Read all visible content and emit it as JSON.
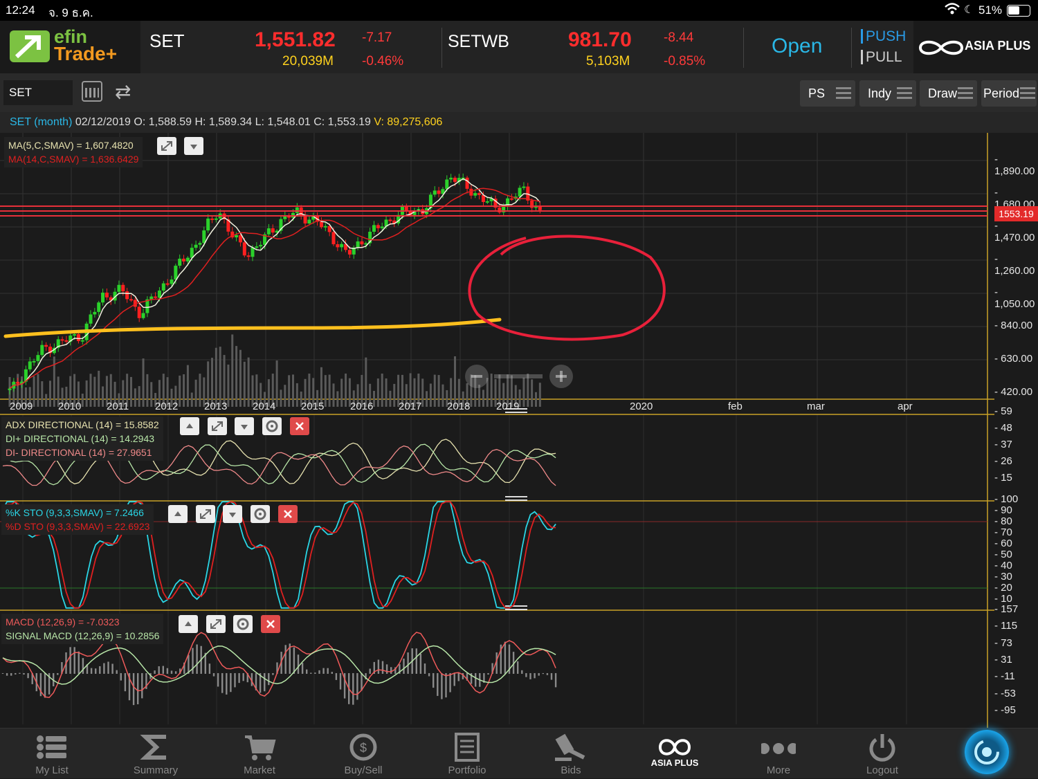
{
  "status": {
    "time": "12:24",
    "date": "จ. 9 ธ.ค.",
    "battery": "51%"
  },
  "header": {
    "logo_top": "efin",
    "logo_bottom": "Trade+",
    "set": {
      "name": "SET",
      "price": "1,551.82",
      "change": "-7.17",
      "volume": "20,039M",
      "pct": "-0.46%"
    },
    "setwb": {
      "name": "SETWB",
      "price": "981.70",
      "change": "-8.44",
      "volume": "5,103M",
      "pct": "-0.85%"
    },
    "market_status": "Open",
    "push": "PUSH",
    "pull": "PULL",
    "broker": "ASIA PLUS"
  },
  "toolbar": {
    "symbol": "SET",
    "ps": "PS",
    "indy": "Indy",
    "draw": "Draw",
    "period": "Period"
  },
  "info": {
    "title": "SET (month)",
    "date": "02/12/2019",
    "o_label": "O:",
    "o": "1,588.59",
    "h_label": "H:",
    "h": "1,589.34",
    "l_label": "L:",
    "l": "1,548.01",
    "c_label": "C:",
    "c": "1,553.19",
    "v_label": "V:",
    "v": "89,275,606"
  },
  "price_panel": {
    "ma5": "MA(5,C,SMAV) = 1,607.4820",
    "ma14": "MA(14,C,SMAV) = 1,636.6429",
    "y_labels": [
      "1,890.00",
      "1,680.00",
      "1,470.00",
      "1,260.00",
      "1,050.00",
      "840.00",
      "630.00",
      "420.00"
    ],
    "last_price": "1553.19",
    "x_labels": [
      "2009",
      "2010",
      "2011",
      "2012",
      "2013",
      "2014",
      "2015",
      "2016",
      "2017",
      "2018",
      "2019",
      "2020",
      "feb",
      "mar",
      "apr"
    ]
  },
  "adx_panel": {
    "adx": "ADX DIRECTIONAL (14) = 15.8582",
    "di_plus": "DI+ DIRECTIONAL (14) = 14.2943",
    "di_minus": "DI- DIRECTIONAL (14) = 27.9651",
    "y_labels": [
      "59",
      "48",
      "37",
      "26",
      "15"
    ]
  },
  "sto_panel": {
    "k": "%K STO (9,3,3,SMAV) = 7.2466",
    "d": "%D STO (9,3,3,SMAV) = 22.6923",
    "y_labels": [
      "100",
      "90",
      "80",
      "70",
      "60",
      "50",
      "40",
      "30",
      "20",
      "10"
    ]
  },
  "macd_panel": {
    "macd": "MACD (12,26,9) = -7.0323",
    "signal": "SIGNAL MACD (12,26,9) = 10.2856",
    "y_labels": [
      "157",
      "115",
      "73",
      "31",
      "-11",
      "-53",
      "-95"
    ]
  },
  "nav": [
    "My List",
    "Summary",
    "Market",
    "Buy/Sell",
    "Portfolio",
    "Bids",
    "ASIA PLUS",
    "More",
    "Logout"
  ],
  "colors": {
    "up": "#2bd12b",
    "down": "#ff2020",
    "accent": "#2ab7e6",
    "annotation_red": "#e8203a",
    "annotation_yellow": "#ffc01e"
  }
}
